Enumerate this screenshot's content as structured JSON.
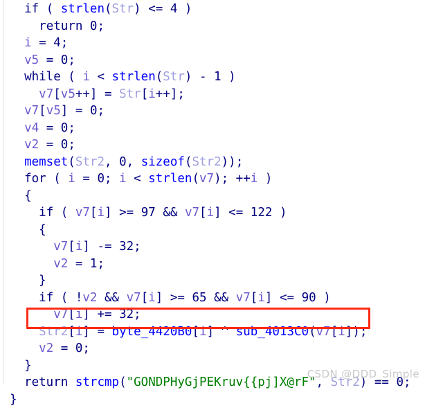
{
  "app": {
    "view_name": "decompiler-pseudocode",
    "background_color": "#ffffff"
  },
  "theme": {
    "keyword_color": "#000080",
    "function_color": "#0000ff",
    "local_var_color": "#6a5acd",
    "argument_color": "#9f9fdf",
    "string_color": "#008000",
    "number_color": "#000080",
    "punctuation_color": "#000080",
    "annotation_box_color": "#fc2b15",
    "watermark_color": "#c9c9c9"
  },
  "annotation": {
    "shape": "rectangle",
    "target_line_index": 18,
    "target_line_text": "Str2[i] = byte_4420B0[i] ^ sub_4013C0(v7[i]);"
  },
  "watermark": {
    "text": "CSDN @DDD_Simple"
  },
  "code": {
    "language": "c-pseudocode",
    "lines": [
      {
        "index": 0,
        "indent": 1,
        "text": "if ( strlen(Str) <= 4 )",
        "tokens": [
          {
            "t": "if",
            "c": "kw"
          },
          {
            "t": " ( ",
            "c": "pun"
          },
          {
            "t": "strlen",
            "c": "fn"
          },
          {
            "t": "(",
            "c": "pun"
          },
          {
            "t": "Str",
            "c": "arg"
          },
          {
            "t": ") <= ",
            "c": "pun"
          },
          {
            "t": "4",
            "c": "num"
          },
          {
            "t": " )",
            "c": "pun"
          }
        ]
      },
      {
        "index": 1,
        "indent": 2,
        "text": "return 0;",
        "tokens": [
          {
            "t": "return",
            "c": "kw"
          },
          {
            "t": " ",
            "c": "pun"
          },
          {
            "t": "0",
            "c": "num"
          },
          {
            "t": ";",
            "c": "pun"
          }
        ]
      },
      {
        "index": 2,
        "indent": 1,
        "text": "i = 4;",
        "tokens": [
          {
            "t": "i",
            "c": "var"
          },
          {
            "t": " = ",
            "c": "pun"
          },
          {
            "t": "4",
            "c": "num"
          },
          {
            "t": ";",
            "c": "pun"
          }
        ]
      },
      {
        "index": 3,
        "indent": 1,
        "text": "v5 = 0;",
        "tokens": [
          {
            "t": "v5",
            "c": "var"
          },
          {
            "t": " = ",
            "c": "pun"
          },
          {
            "t": "0",
            "c": "num"
          },
          {
            "t": ";",
            "c": "pun"
          }
        ]
      },
      {
        "index": 4,
        "indent": 1,
        "text": "while ( i < strlen(Str) - 1 )",
        "tokens": [
          {
            "t": "while",
            "c": "kw"
          },
          {
            "t": " ( ",
            "c": "pun"
          },
          {
            "t": "i",
            "c": "var"
          },
          {
            "t": " < ",
            "c": "pun"
          },
          {
            "t": "strlen",
            "c": "fn"
          },
          {
            "t": "(",
            "c": "pun"
          },
          {
            "t": "Str",
            "c": "arg"
          },
          {
            "t": ") - ",
            "c": "pun"
          },
          {
            "t": "1",
            "c": "num"
          },
          {
            "t": " )",
            "c": "pun"
          }
        ]
      },
      {
        "index": 5,
        "indent": 2,
        "text": "v7[v5++] = Str[i++];",
        "tokens": [
          {
            "t": "v7",
            "c": "var"
          },
          {
            "t": "[",
            "c": "pun"
          },
          {
            "t": "v5",
            "c": "var"
          },
          {
            "t": "++] = ",
            "c": "pun"
          },
          {
            "t": "Str",
            "c": "arg"
          },
          {
            "t": "[",
            "c": "pun"
          },
          {
            "t": "i",
            "c": "var"
          },
          {
            "t": "++];",
            "c": "pun"
          }
        ]
      },
      {
        "index": 6,
        "indent": 1,
        "text": "v7[v5] = 0;",
        "tokens": [
          {
            "t": "v7",
            "c": "var"
          },
          {
            "t": "[",
            "c": "pun"
          },
          {
            "t": "v5",
            "c": "var"
          },
          {
            "t": "] = ",
            "c": "pun"
          },
          {
            "t": "0",
            "c": "num"
          },
          {
            "t": ";",
            "c": "pun"
          }
        ]
      },
      {
        "index": 7,
        "indent": 1,
        "text": "v4 = 0;",
        "tokens": [
          {
            "t": "v4",
            "c": "var"
          },
          {
            "t": " = ",
            "c": "pun"
          },
          {
            "t": "0",
            "c": "num"
          },
          {
            "t": ";",
            "c": "pun"
          }
        ]
      },
      {
        "index": 8,
        "indent": 1,
        "text": "v2 = 0;",
        "tokens": [
          {
            "t": "v2",
            "c": "var"
          },
          {
            "t": " = ",
            "c": "pun"
          },
          {
            "t": "0",
            "c": "num"
          },
          {
            "t": ";",
            "c": "pun"
          }
        ]
      },
      {
        "index": 9,
        "indent": 1,
        "text": "memset(Str2, 0, sizeof(Str2));",
        "tokens": [
          {
            "t": "memset",
            "c": "fn"
          },
          {
            "t": "(",
            "c": "pun"
          },
          {
            "t": "Str2",
            "c": "arg"
          },
          {
            "t": ", ",
            "c": "pun"
          },
          {
            "t": "0",
            "c": "num"
          },
          {
            "t": ", ",
            "c": "pun"
          },
          {
            "t": "sizeof",
            "c": "fn"
          },
          {
            "t": "(",
            "c": "pun"
          },
          {
            "t": "Str2",
            "c": "arg"
          },
          {
            "t": "));",
            "c": "pun"
          }
        ]
      },
      {
        "index": 10,
        "indent": 1,
        "text": "for ( i = 0; i < strlen(v7); ++i )",
        "tokens": [
          {
            "t": "for",
            "c": "kw"
          },
          {
            "t": " ( ",
            "c": "pun"
          },
          {
            "t": "i",
            "c": "var"
          },
          {
            "t": " = ",
            "c": "pun"
          },
          {
            "t": "0",
            "c": "num"
          },
          {
            "t": "; ",
            "c": "pun"
          },
          {
            "t": "i",
            "c": "var"
          },
          {
            "t": " < ",
            "c": "pun"
          },
          {
            "t": "strlen",
            "c": "fn"
          },
          {
            "t": "(",
            "c": "pun"
          },
          {
            "t": "v7",
            "c": "var"
          },
          {
            "t": "); ++",
            "c": "pun"
          },
          {
            "t": "i",
            "c": "var"
          },
          {
            "t": " )",
            "c": "pun"
          }
        ]
      },
      {
        "index": 11,
        "indent": 1,
        "text": "{",
        "tokens": [
          {
            "t": "{",
            "c": "pun"
          }
        ]
      },
      {
        "index": 12,
        "indent": 2,
        "text": "if ( v7[i] >= 97 && v7[i] <= 122 )",
        "tokens": [
          {
            "t": "if",
            "c": "kw"
          },
          {
            "t": " ( ",
            "c": "pun"
          },
          {
            "t": "v7",
            "c": "var"
          },
          {
            "t": "[",
            "c": "pun"
          },
          {
            "t": "i",
            "c": "var"
          },
          {
            "t": "] >= ",
            "c": "pun"
          },
          {
            "t": "97",
            "c": "num"
          },
          {
            "t": " && ",
            "c": "pun"
          },
          {
            "t": "v7",
            "c": "var"
          },
          {
            "t": "[",
            "c": "pun"
          },
          {
            "t": "i",
            "c": "var"
          },
          {
            "t": "] <= ",
            "c": "pun"
          },
          {
            "t": "122",
            "c": "num"
          },
          {
            "t": " )",
            "c": "pun"
          }
        ]
      },
      {
        "index": 13,
        "indent": 2,
        "text": "{",
        "tokens": [
          {
            "t": "{",
            "c": "pun"
          }
        ]
      },
      {
        "index": 14,
        "indent": 3,
        "text": "v7[i] -= 32;",
        "tokens": [
          {
            "t": "v7",
            "c": "var"
          },
          {
            "t": "[",
            "c": "pun"
          },
          {
            "t": "i",
            "c": "var"
          },
          {
            "t": "] -= ",
            "c": "pun"
          },
          {
            "t": "32",
            "c": "num"
          },
          {
            "t": ";",
            "c": "pun"
          }
        ]
      },
      {
        "index": 15,
        "indent": 3,
        "text": "v2 = 1;",
        "tokens": [
          {
            "t": "v2",
            "c": "var"
          },
          {
            "t": " = ",
            "c": "pun"
          },
          {
            "t": "1",
            "c": "num"
          },
          {
            "t": ";",
            "c": "pun"
          }
        ]
      },
      {
        "index": 16,
        "indent": 2,
        "text": "}",
        "tokens": [
          {
            "t": "}",
            "c": "pun"
          }
        ]
      },
      {
        "index": 17,
        "indent": 2,
        "text": "if ( !v2 && v7[i] >= 65 && v7[i] <= 90 )",
        "tokens": [
          {
            "t": "if",
            "c": "kw"
          },
          {
            "t": " ( !",
            "c": "pun"
          },
          {
            "t": "v2",
            "c": "var"
          },
          {
            "t": " && ",
            "c": "pun"
          },
          {
            "t": "v7",
            "c": "var"
          },
          {
            "t": "[",
            "c": "pun"
          },
          {
            "t": "i",
            "c": "var"
          },
          {
            "t": "] >= ",
            "c": "pun"
          },
          {
            "t": "65",
            "c": "num"
          },
          {
            "t": " && ",
            "c": "pun"
          },
          {
            "t": "v7",
            "c": "var"
          },
          {
            "t": "[",
            "c": "pun"
          },
          {
            "t": "i",
            "c": "var"
          },
          {
            "t": "] <= ",
            "c": "pun"
          },
          {
            "t": "90",
            "c": "num"
          },
          {
            "t": " )",
            "c": "pun"
          }
        ]
      },
      {
        "index": 18,
        "indent": 3,
        "text": "v7[i] += 32;",
        "tokens": [
          {
            "t": "v7",
            "c": "var"
          },
          {
            "t": "[",
            "c": "pun"
          },
          {
            "t": "i",
            "c": "var"
          },
          {
            "t": "] += ",
            "c": "pun"
          },
          {
            "t": "32",
            "c": "num"
          },
          {
            "t": ";",
            "c": "pun"
          }
        ]
      },
      {
        "index": 19,
        "indent": 2,
        "text": "Str2[i] = byte_4420B0[i] ^ sub_4013C0(v7[i]);",
        "highlighted": true,
        "tokens": [
          {
            "t": "Str2",
            "c": "arg"
          },
          {
            "t": "[",
            "c": "pun"
          },
          {
            "t": "i",
            "c": "var"
          },
          {
            "t": "] = ",
            "c": "pun"
          },
          {
            "t": "byte_4420B0",
            "c": "fn"
          },
          {
            "t": "[",
            "c": "pun"
          },
          {
            "t": "i",
            "c": "var"
          },
          {
            "t": "] ^ ",
            "c": "pun"
          },
          {
            "t": "sub_4013C0",
            "c": "fn"
          },
          {
            "t": "(",
            "c": "pun"
          },
          {
            "t": "v7",
            "c": "var"
          },
          {
            "t": "[",
            "c": "pun"
          },
          {
            "t": "i",
            "c": "var"
          },
          {
            "t": "]);",
            "c": "pun"
          }
        ]
      },
      {
        "index": 20,
        "indent": 2,
        "text": "v2 = 0;",
        "tokens": [
          {
            "t": "v2",
            "c": "var"
          },
          {
            "t": " = ",
            "c": "pun"
          },
          {
            "t": "0",
            "c": "num"
          },
          {
            "t": ";",
            "c": "pun"
          }
        ]
      },
      {
        "index": 21,
        "indent": 1,
        "text": "}",
        "tokens": [
          {
            "t": "}",
            "c": "pun"
          }
        ]
      },
      {
        "index": 22,
        "indent": 1,
        "text": "return strcmp(\"GONDPHyGjPEKruv{{pj]X@rF\", Str2) == 0;",
        "tokens": [
          {
            "t": "return",
            "c": "kw"
          },
          {
            "t": " ",
            "c": "pun"
          },
          {
            "t": "strcmp",
            "c": "fn"
          },
          {
            "t": "(",
            "c": "pun"
          },
          {
            "t": "\"GONDPHyGjPEKruv{{pj]X@rF\"",
            "c": "str"
          },
          {
            "t": ", ",
            "c": "pun"
          },
          {
            "t": "Str2",
            "c": "arg"
          },
          {
            "t": ") == ",
            "c": "pun"
          },
          {
            "t": "0",
            "c": "num"
          },
          {
            "t": ";",
            "c": "pun"
          }
        ]
      },
      {
        "index": 23,
        "indent": 0,
        "text": "}",
        "tokens": [
          {
            "t": "}",
            "c": "pun"
          }
        ]
      }
    ]
  }
}
